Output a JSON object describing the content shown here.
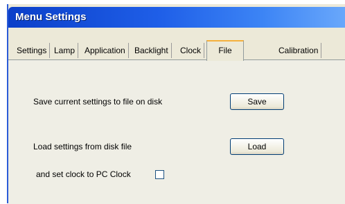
{
  "window": {
    "title": "Menu Settings"
  },
  "tabs": [
    {
      "label": "Settings"
    },
    {
      "label": "Lamp"
    },
    {
      "label": "Application"
    },
    {
      "label": "Backlight"
    },
    {
      "label": "Clock"
    },
    {
      "label": "File"
    },
    {
      "label": "Calibration"
    }
  ],
  "active_tab": "File",
  "file_tab": {
    "save_text": "Save current settings to file on disk",
    "save_button": "Save",
    "load_text": "Load settings from disk file",
    "load_button": "Load",
    "clock_text": "and set clock to PC Clock",
    "clock_checked": false
  },
  "colors": {
    "titlebar": "#1f5fe8",
    "active_tab_accent": "#f5b03c",
    "panel_bg": "#ece9d8"
  }
}
